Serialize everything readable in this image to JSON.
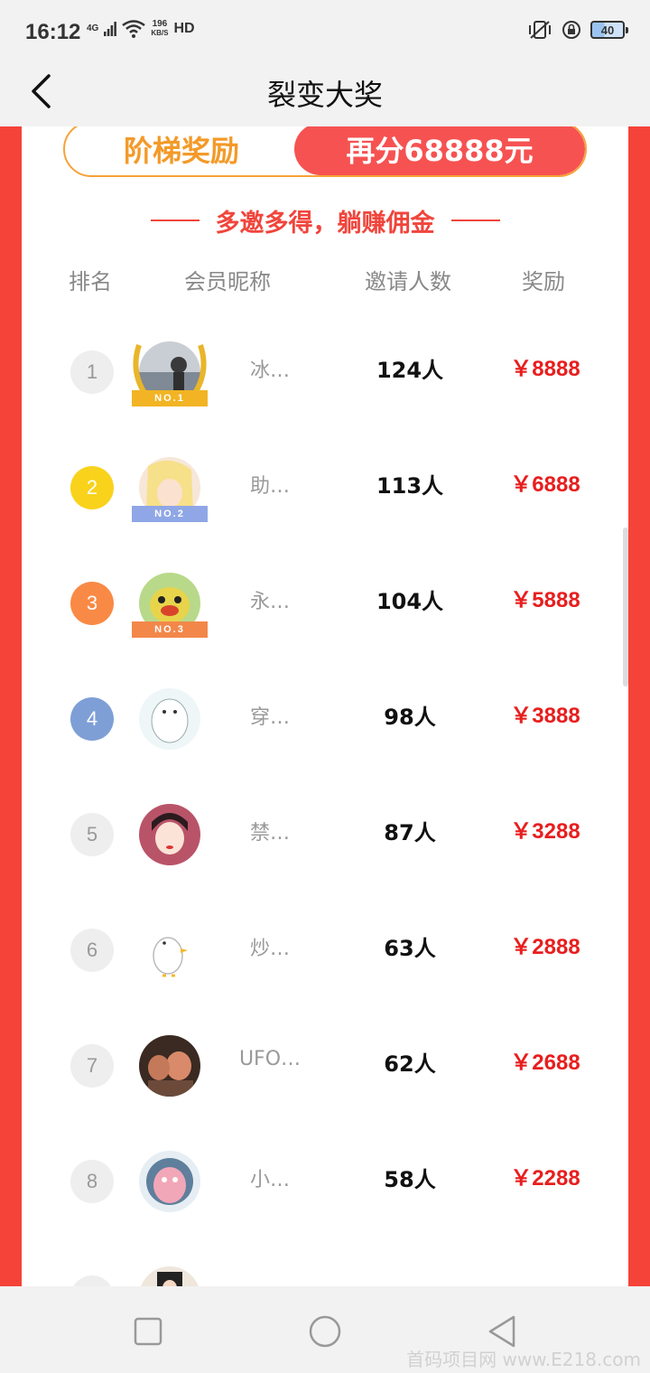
{
  "status_bar": {
    "time": "16:12",
    "network": "4G",
    "speed_value": "196",
    "speed_unit": "KB/S",
    "hd": "HD",
    "battery": "40"
  },
  "header": {
    "title": "裂变大奖"
  },
  "tabs": {
    "left": "阶梯奖励",
    "right": "再分68888元"
  },
  "slogan": "多邀多得，躺赚佣金",
  "columns": {
    "rank": "排名",
    "nickname": "会员昵称",
    "invites": "邀请人数",
    "reward": "奖励"
  },
  "rows": [
    {
      "rank": "1",
      "nickname": "冰…",
      "count": "124人",
      "reward": "￥8888",
      "medal": "NO.1"
    },
    {
      "rank": "2",
      "nickname": "助…",
      "count": "113人",
      "reward": "￥6888",
      "medal": "NO.2"
    },
    {
      "rank": "3",
      "nickname": "永…",
      "count": "104人",
      "reward": "￥5888",
      "medal": "NO.3"
    },
    {
      "rank": "4",
      "nickname": "穿…",
      "count": "98人",
      "reward": "￥3888"
    },
    {
      "rank": "5",
      "nickname": "禁…",
      "count": "87人",
      "reward": "￥3288"
    },
    {
      "rank": "6",
      "nickname": "炒…",
      "count": "63人",
      "reward": "￥2888"
    },
    {
      "rank": "7",
      "nickname": "UFO…",
      "count": "62人",
      "reward": "￥2688"
    },
    {
      "rank": "8",
      "nickname": "小…",
      "count": "58人",
      "reward": "￥2288"
    }
  ],
  "colors": {
    "frame_red": "#f5433a",
    "tab_orange": "#f39a29",
    "tab_active": "#f65252",
    "reward_red": "#e81e1e",
    "rank1": "#eeeeee",
    "rank2": "#f9d21b",
    "rank3": "#f98a45",
    "rank4": "#7e9fd6"
  },
  "watermark": "首码项目网 www.E218.com"
}
